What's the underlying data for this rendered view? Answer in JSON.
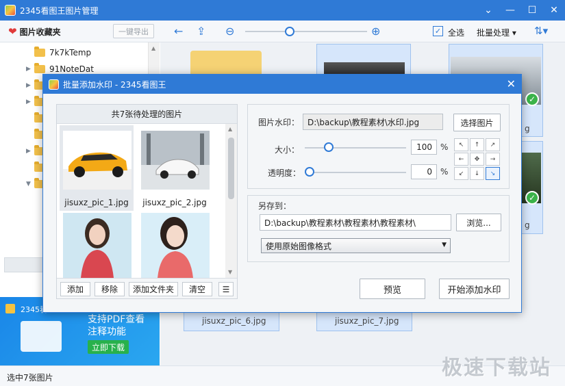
{
  "window": {
    "title": "2345看图王图片管理",
    "controls": [
      "⌄",
      "—",
      "☐",
      "✕"
    ]
  },
  "toolbar": {
    "favorites_label": "图片收藏夹",
    "export_label": "一键导出",
    "select_all_label": "全选",
    "batch_label": "批量处理 ▾",
    "zoom_level": 0.35
  },
  "tree": [
    "7k7kTemp",
    "91NoteDat"
  ],
  "content": {
    "labels": [
      "jisuxz_pic_6.jpg",
      "jisuxz_pic_7.jpg"
    ],
    "side_label_1": "g",
    "side_label_2": "g"
  },
  "ad": {
    "title": "2345看",
    "line1": "支持PDF查看",
    "line2": "注释功能",
    "download": "立即下载"
  },
  "status": {
    "text": "选中7张图片"
  },
  "watermark": "极速下载站",
  "dialog": {
    "title": "批量添加水印 - 2345看图王",
    "list_header": "共7张待处理的图片",
    "items": [
      {
        "name": "jisuxz_pic_1.jpg"
      },
      {
        "name": "jisuxz_pic_2.jpg"
      },
      {
        "name": ""
      },
      {
        "name": ""
      }
    ],
    "list_buttons": {
      "add": "添加",
      "remove": "移除",
      "add_folder": "添加文件夹",
      "clear": "清空"
    },
    "watermark_label": "图片水印：",
    "watermark_path": "D:\\backup\\教程素材\\水印.jpg",
    "choose_image": "选择图片",
    "size_label": "大小：",
    "size_value": "100",
    "opacity_label": "透明度：",
    "opacity_value": "0",
    "percent": "%",
    "save_to_label": "另存到：",
    "save_path": "D:\\backup\\教程素材\\教程素材\\教程素材\\",
    "browse": "浏览...",
    "format": "使用原始图像格式",
    "preview": "预览",
    "start": "开始添加水印"
  }
}
